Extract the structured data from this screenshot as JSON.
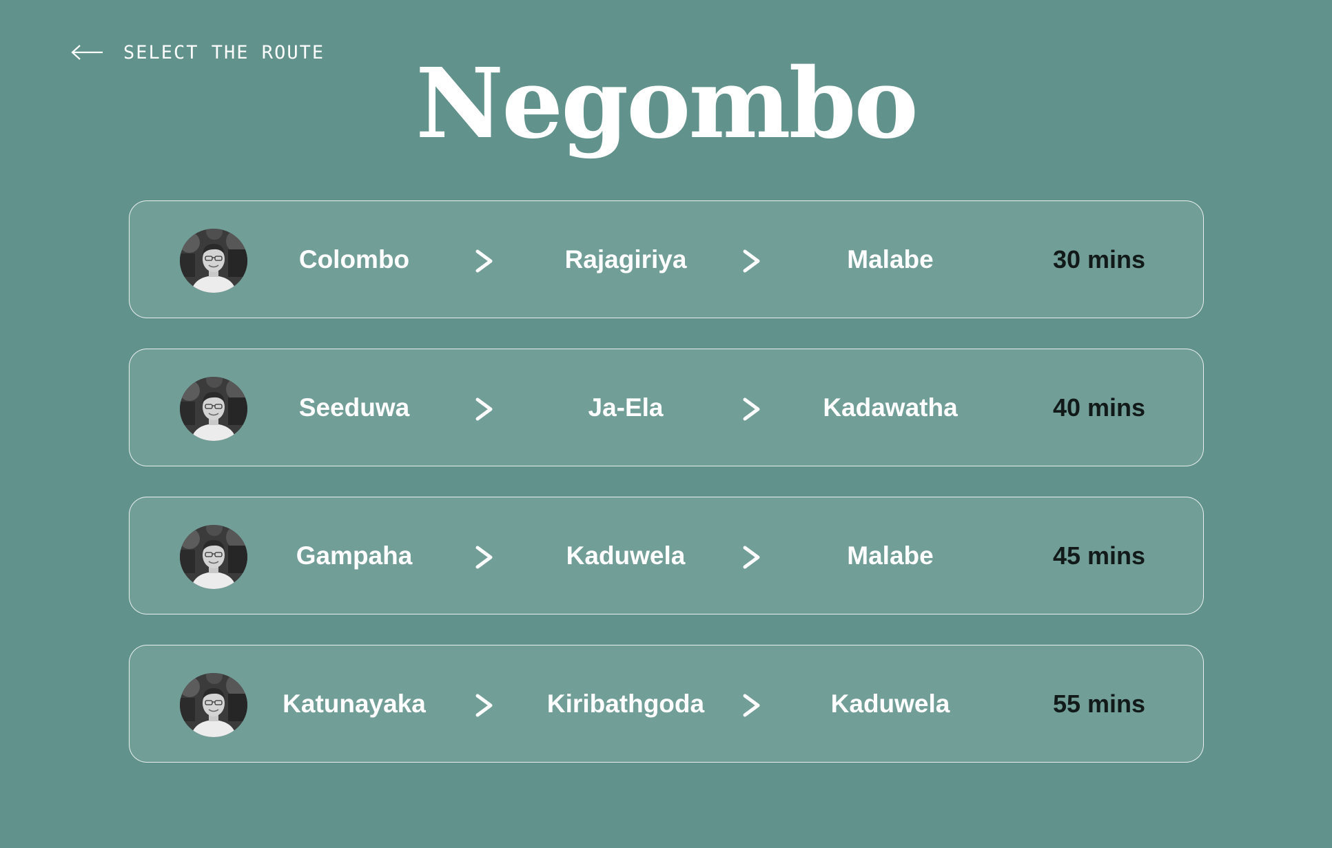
{
  "header": {
    "back_label": "SELECT THE ROUTE",
    "title": "Negombo"
  },
  "icons": {
    "back": "arrow-left-icon",
    "separator": "chevron-right-icon",
    "avatar": "driver-avatar"
  },
  "colors": {
    "background": "#61928c",
    "card_fill": "rgba(255,255,255,0.11)",
    "card_border": "#ffffff",
    "text": "#ffffff",
    "duration_text": "#111a18"
  },
  "routes": [
    {
      "stops": [
        "Colombo",
        "Rajagiriya",
        "Malabe"
      ],
      "duration": "30 mins"
    },
    {
      "stops": [
        "Seeduwa",
        "Ja-Ela",
        "Kadawatha"
      ],
      "duration": "40 mins"
    },
    {
      "stops": [
        "Gampaha",
        "Kaduwela",
        "Malabe"
      ],
      "duration": "45 mins"
    },
    {
      "stops": [
        "Katunayaka",
        "Kiribathgoda",
        "Kaduwela"
      ],
      "duration": "55 mins"
    }
  ]
}
